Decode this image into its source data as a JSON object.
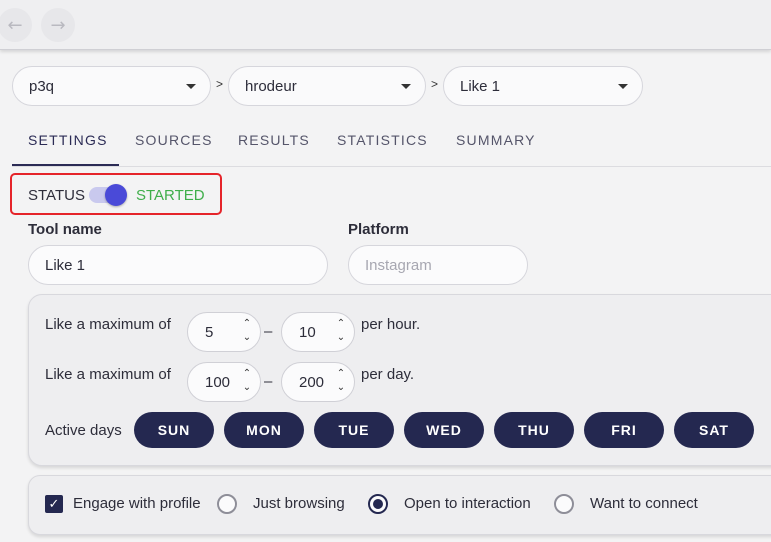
{
  "nav": {
    "back_icon": "←",
    "forward_icon": "→"
  },
  "breadcrumb": {
    "items": [
      {
        "label": "p3q"
      },
      {
        "label": "hrodeur"
      },
      {
        "label": "Like 1"
      }
    ],
    "separator": ">"
  },
  "tabs": [
    {
      "label": "SETTINGS",
      "active": true
    },
    {
      "label": "SOURCES",
      "active": false
    },
    {
      "label": "RESULTS",
      "active": false
    },
    {
      "label": "STATISTICS",
      "active": false
    },
    {
      "label": "SUMMARY",
      "active": false
    }
  ],
  "status": {
    "label": "STATUS",
    "value": "STARTED",
    "on": true,
    "value_color": "#3fae4a"
  },
  "form": {
    "tool_name_label": "Tool name",
    "tool_name_value": "Like 1",
    "platform_label": "Platform",
    "platform_placeholder": "Instagram"
  },
  "limits": {
    "hour": {
      "label": "Like a maximum of",
      "min": "5",
      "max": "10",
      "unit": "per hour."
    },
    "day": {
      "label": "Like a maximum of",
      "min": "100",
      "max": "200",
      "unit": "per day."
    },
    "dash": "–",
    "spin_up": "⌃",
    "spin_down": "⌄"
  },
  "active_days": {
    "label": "Active days",
    "days": [
      "SUN",
      "MON",
      "TUE",
      "WED",
      "THU",
      "FRI",
      "SAT"
    ]
  },
  "engagement": {
    "checkbox_label": "Engage with profile",
    "checkbox_checked": true,
    "check_glyph": "✓",
    "options": [
      {
        "label": "Just browsing",
        "selected": false
      },
      {
        "label": "Open to interaction",
        "selected": true
      },
      {
        "label": "Want to connect",
        "selected": false
      }
    ]
  },
  "colors": {
    "accent": "#242850",
    "highlight_border": "#e5242a",
    "toggle": "#4a4ad8"
  }
}
